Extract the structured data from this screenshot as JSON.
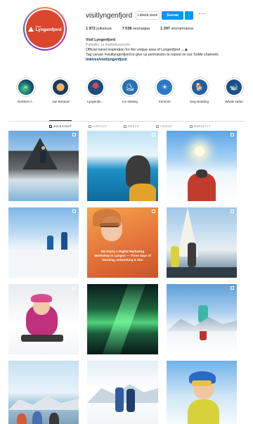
{
  "profile": {
    "username": "visitlyngenfjord",
    "avatar_logo_line1": "Lyngenfjord",
    "avatar_logo_line2": "Visit",
    "buttons": {
      "message": "Lähetä viesti",
      "follow": "Seuraa",
      "dropdown_icon": "chevron-down-icon",
      "more": "···"
    },
    "stats": [
      {
        "count": "1 972",
        "label": "julkaisua"
      },
      {
        "count": "7 538",
        "label": "seuraajaa"
      },
      {
        "count": "1 297",
        "label": "seurannassa"
      }
    ],
    "bio": {
      "name": "Visit Lyngenfjord",
      "category": "Paikallis- ja matkailuasiusto",
      "line1": "Official travel inspiration for the unique area of Lyngenfjord ↔⛰",
      "line2": "Tag us/use #visitlyngenfjord to give us permission to repost on our SoMe channels",
      "link": "linktree/visitlyngenfjord"
    }
  },
  "highlights": [
    {
      "label": "Northern l...",
      "icon": "aurora-icon",
      "color": "#1b5e8c"
    },
    {
      "label": "Jan Bostrud",
      "icon": "person-icon",
      "color": "#2d5a87"
    },
    {
      "label": "Lyngenfjo...",
      "icon": "person-icon",
      "color": "#1e4d7a"
    },
    {
      "label": "Ice skating",
      "icon": "skating-icon",
      "color": "#2a6fb0"
    },
    {
      "label": "Summer",
      "icon": "sun-icon",
      "color": "#2b78c5"
    },
    {
      "label": "Dog sledding",
      "icon": "dog-icon",
      "color": "#1f5fa0"
    },
    {
      "label": "Whale safari",
      "icon": "whale-icon",
      "color": "#1a4f85"
    }
  ],
  "tabs": [
    {
      "label": "JULKAISUT",
      "icon": "grid-icon",
      "active": true
    },
    {
      "label": "KIPPAAT",
      "icon": "bookmark-icon",
      "active": false
    },
    {
      "label": "REELS",
      "icon": "reels-icon",
      "active": false
    },
    {
      "label": "VIDEOT",
      "icon": "video-icon",
      "active": false
    },
    {
      "label": "MERKITYT",
      "icon": "tag-icon",
      "active": false
    }
  ],
  "posts": [
    {
      "name": "post-jumping-mountains",
      "badge": true
    },
    {
      "name": "post-dog-glacier",
      "badge": true
    },
    {
      "name": "post-sled-sun",
      "badge": true
    },
    {
      "name": "post-hikers-snow",
      "badge": true
    },
    {
      "name": "post-workshop-selfie",
      "badge": true,
      "text": "Ms Starly x Digital Marketing Workshop in Lyngen — Three days of learning, networking & fun!"
    },
    {
      "name": "post-sailing",
      "badge": true
    },
    {
      "name": "post-sledding-kid",
      "badge": true
    },
    {
      "name": "post-aurora",
      "badge": false
    },
    {
      "name": "post-skier-peak",
      "badge": true
    },
    {
      "name": "post-group-fjord",
      "badge": false
    },
    {
      "name": "post-couple-snow",
      "badge": false
    },
    {
      "name": "post-smiling-skier",
      "badge": false
    }
  ]
}
